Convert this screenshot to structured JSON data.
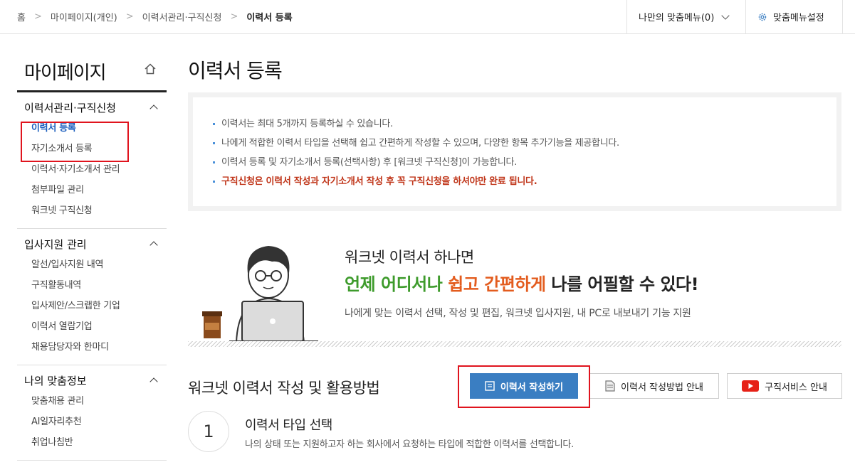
{
  "breadcrumb": {
    "items": [
      "홈",
      "마이페이지(개인)",
      "이력서관리·구직신청",
      "이력서 등록"
    ]
  },
  "top_menu": {
    "my_menu": "나만의 맞춤메뉴(0)",
    "settings": "맞춤메뉴설정"
  },
  "sidebar": {
    "title": "마이페이지",
    "groups": [
      {
        "label": "이력서관리·구직신청",
        "items": [
          "이력서 등록",
          "자기소개서 등록",
          "이력서·자기소개서 관리",
          "첨부파일 관리",
          "워크넷 구직신청"
        ]
      },
      {
        "label": "입사지원 관리",
        "items": [
          "알선/입사지원 내역",
          "구직활동내역",
          "입사제안/스크랩한 기업",
          "이력서 열람기업",
          "채용담당자와 한마디"
        ]
      },
      {
        "label": "나의 맞춤정보",
        "items": [
          "맞춤채용 관리",
          "AI일자리추천",
          "취업나침반"
        ]
      }
    ]
  },
  "main": {
    "title": "이력서 등록",
    "notices": [
      "이력서는 최대 5개까지 등록하실 수 있습니다.",
      "나에게 적합한 이력서 타입을 선택해 쉽고 간편하게 작성할 수 있으며, 다양한 항목 추가기능을 제공합니다.",
      "이력서 등록 및 자기소개서 등록(선택사항) 후 [워크넷 구직신청]이 가능합니다.",
      "구직신청은 이력서 작성과 자기소개서 작성 후 꼭 구직신청을 하셔야만 완료 됩니다."
    ],
    "banner": {
      "line1": "워크넷 이력서 하나면",
      "line2_green": "언제 어디서나",
      "line2_orange": "쉽고 간편하게",
      "line2_rest": "나를 어필할 수 있다!",
      "line3": "나에게 맞는 이력서 선택, 작성 및 편집, 워크넷 입사지원, 내 PC로 내보내기 기능 지원"
    },
    "section_title": "워크넷 이력서 작성 및 활용방법",
    "buttons": {
      "write": "이력서 작성하기",
      "guide": "이력서 작성방법 안내",
      "service": "구직서비스 안내"
    },
    "step": {
      "number": "1",
      "title": "이력서 타입 선택",
      "desc": "나의 상태 또는 지원하고자 하는 회사에서 요청하는 타입에 적합한 이력서를 선택합니다."
    }
  },
  "colors": {
    "primary": "#3a7ec2",
    "active_link": "#1c5ebd",
    "warning": "#c0361a",
    "green": "#3e9b2c",
    "orange": "#e35c1e",
    "highlight_box": "#e0141e"
  },
  "icons": [
    "chevron-down-icon",
    "gear-icon",
    "home-icon",
    "chevron-up-icon",
    "document-icon",
    "youtube-icon"
  ]
}
